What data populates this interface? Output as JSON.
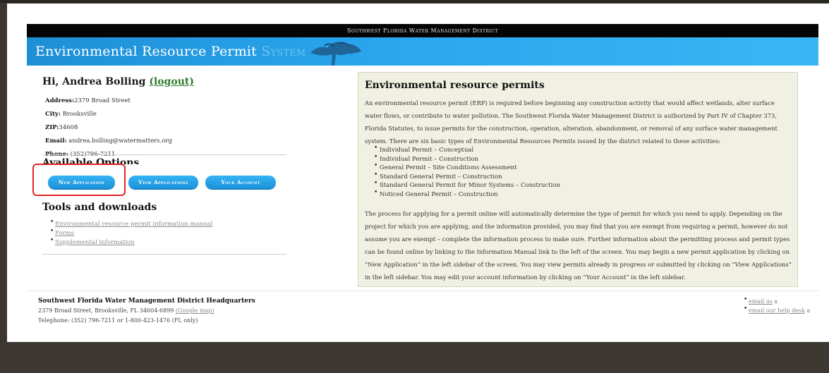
{
  "header": {
    "top_bar": "Southwest Florida Water Management District",
    "banner_title_main": "Environmental Resource Permit",
    "banner_title_faded": "System"
  },
  "user": {
    "greeting": "Hi, Andrea Bolling",
    "logout_label": "(logout)",
    "address_label": "Address:",
    "address": "2379 Broad Street",
    "city_label": "City:",
    "city": "Brooksville",
    "zip_label": "ZIP:",
    "zip": "34608",
    "email_label": "Email:",
    "email": "andrea.bolling@watermatters.org",
    "phone_label": "Phone:",
    "phone": "(352)796-7211"
  },
  "options": {
    "title": "Available Options",
    "new_application": "New Application",
    "view_applications": "View Applications",
    "your_account": "Your Account"
  },
  "tools": {
    "title": "Tools and downloads",
    "items": [
      "Environmental resource permit information manual",
      "Forms",
      "Supplemental information"
    ]
  },
  "panel": {
    "title": "Environmental resource permits",
    "p1": "An environmental resource permit (ERP) is required before beginning any construction activity that would affect wetlands, alter surface water flows, or contribute to water pollution. The Southwest Florida Water Management District is authorized by Part IV of Chapter 373, Florida Statutes, to issue permits for the construction, operation, alteration, abandonment, or removal of any surface water management system. There are six basic types of Environmental Resources Permits issued by the district related to these activities:",
    "permit_types": [
      "Individual Permit – Conceptual",
      "Individual Permit – Construction",
      "General Permit – Site Conditions Assessment",
      "Standard General Permit – Construction",
      "Standard General Permit for Minor Systems – Construction",
      "Noticed General Permit – Construction"
    ],
    "p2": "The process for applying for a permit online will automatically determine the type of permit for which you need to apply. Depending on the project for which you are applying, and the information provided, you may find that you are exempt from requiring a permit, however do not assume you are exempt – complete the information process to make sure. Further information about the permitting process and permit types can be found online by linking to the Information Manual link to the left of the screen. You may begin a new permit application by clicking on “New Application” in the left sidebar of the screen. You may view permits already in progress or submitted by clicking on “View Applications” in the left sidebar. You may edit your account information by clicking on “Your Account” in the left sidebar."
  },
  "footer": {
    "org": "Southwest Florida Water Management District Headquarters",
    "address": "2379 Broad Street, Brooksville, FL 34604-6899",
    "map_link": "(Google map)",
    "telephone": "Telephone: (352) 796-7211 or 1-800-423-1476 (FL only)",
    "links": [
      "email us",
      "email our help desk"
    ]
  }
}
